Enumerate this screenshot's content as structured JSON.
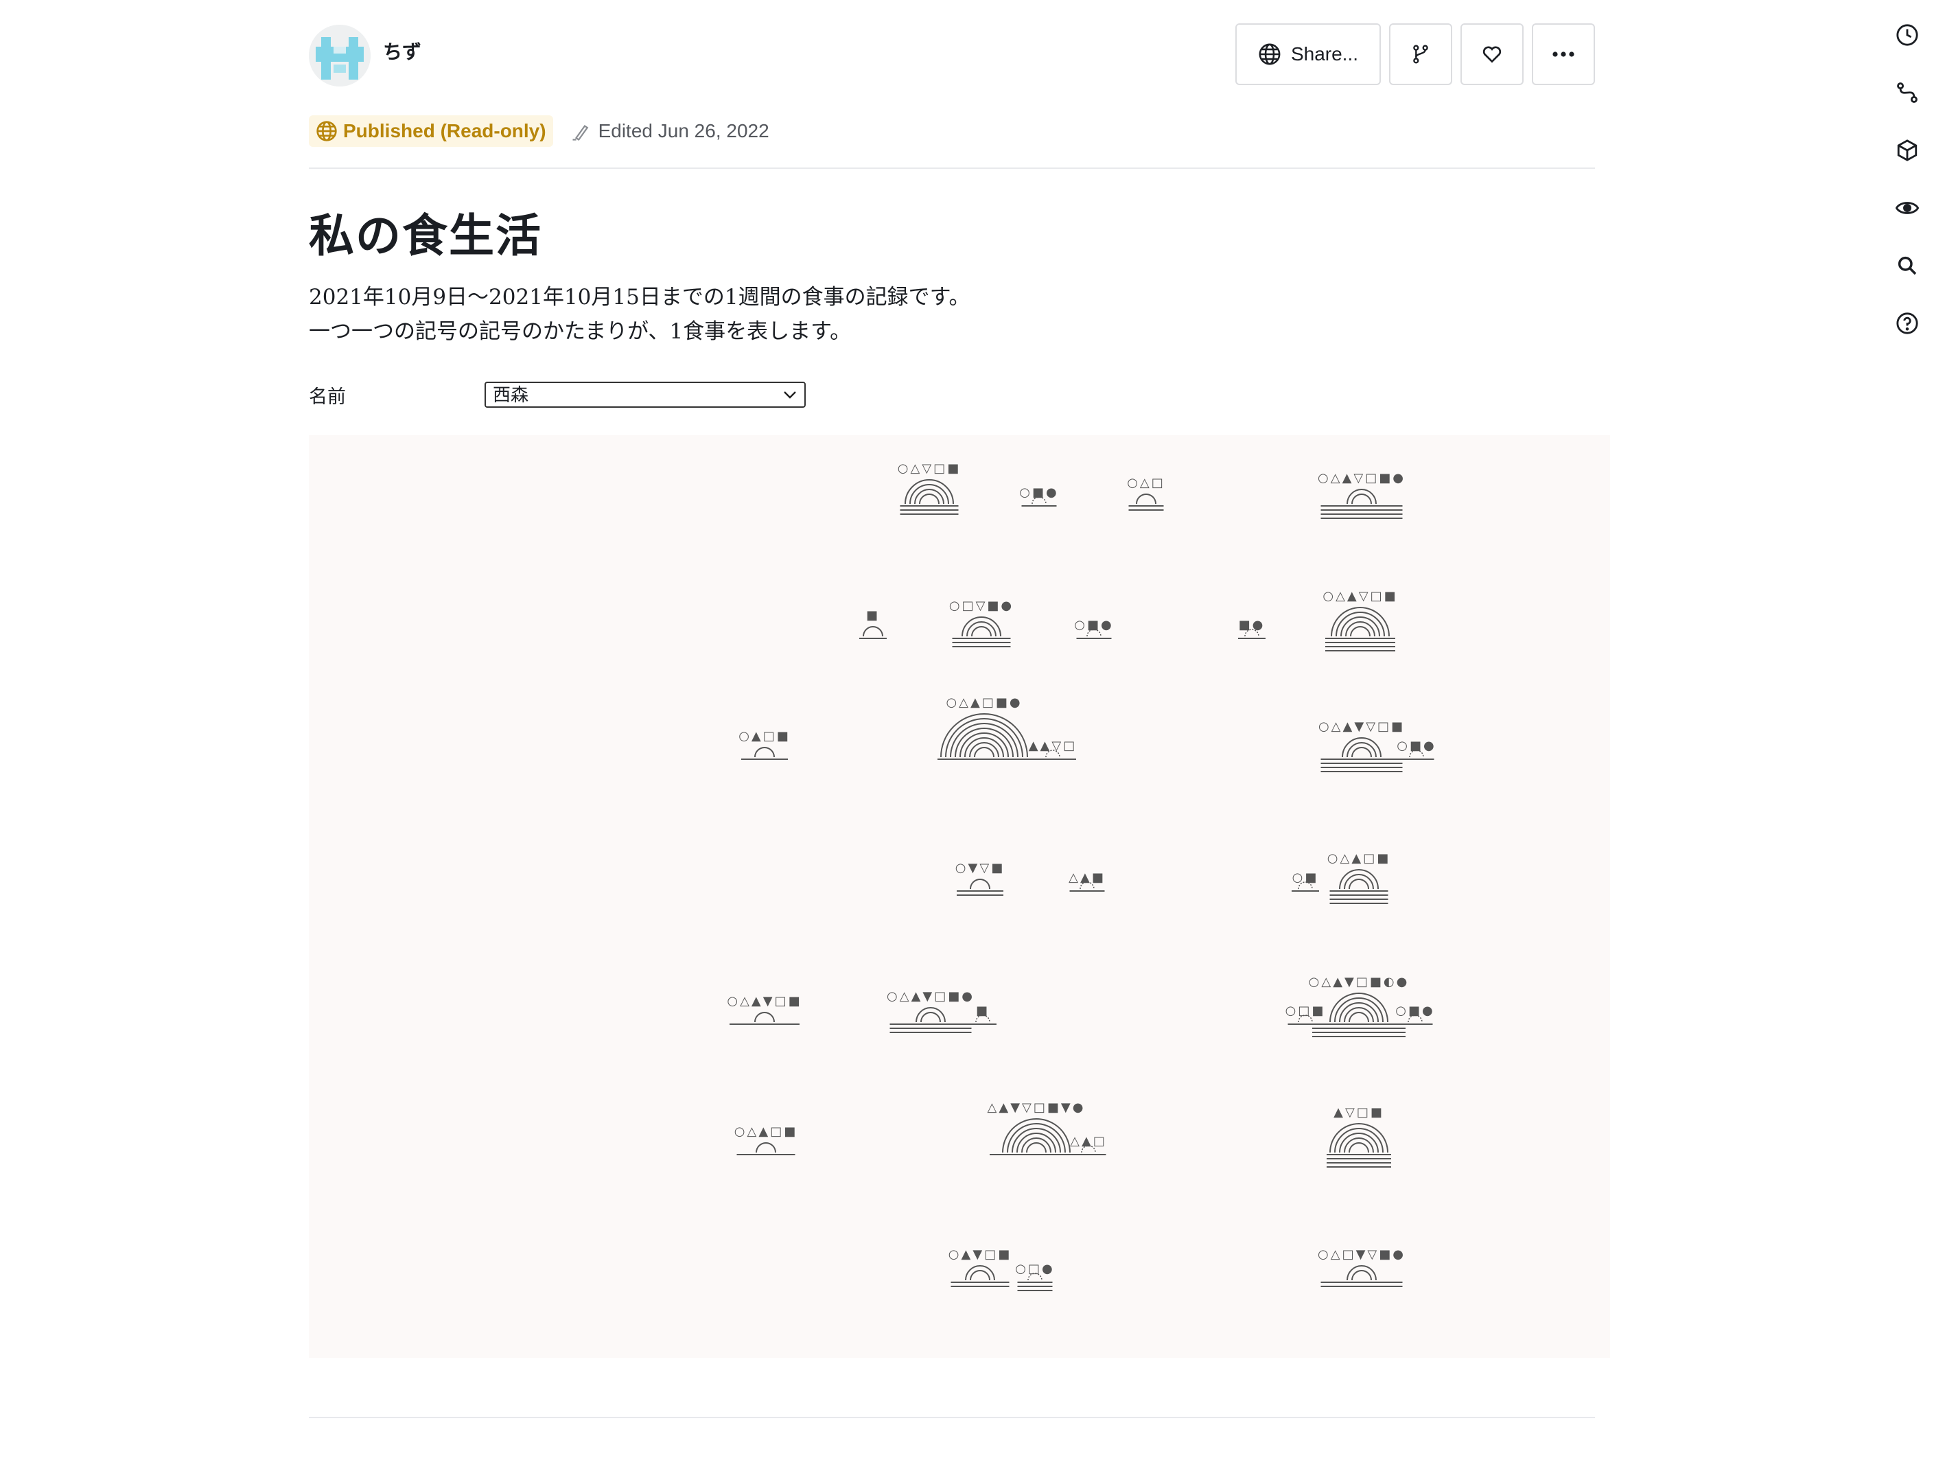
{
  "header": {
    "author_name": "ちず",
    "share_label": "Share...",
    "status_badge": "Published (Read-only)",
    "edited": "Edited Jun 26, 2022"
  },
  "content": {
    "title": "私の食生活",
    "description_lines": [
      "2021年10月9日〜2021年10月15日までの1週間の食事の記録です。",
      "一つ一つの記号の記号のかたまりが、1食事を表します。"
    ],
    "name_label": "名前",
    "name_selected": "西森"
  },
  "colors": {
    "accent": "#b8860b",
    "badge_bg": "#fdf6e3",
    "canvas_bg": "#fcf9f8",
    "avatar": "#7fd3e6",
    "ink": "#555555"
  },
  "icons": {
    "header": [
      "globe-icon",
      "fork-icon",
      "heart-icon",
      "more-icon"
    ],
    "rail": [
      "history-icon",
      "links-icon",
      "package-icon",
      "eye-icon",
      "search-icon",
      "help-icon"
    ]
  },
  "meals": [
    {
      "symbols": "○△▽□■",
      "arcs": 4,
      "lines": 3
    },
    {
      "symbols": "○■●",
      "arcs": 0,
      "lines": 1
    },
    {
      "symbols": "○△□",
      "arcs": 1,
      "lines": 2
    },
    {
      "symbols": "○△▲▽□■●",
      "arcs": 2,
      "lines": 4
    },
    {
      "symbols": "■",
      "arcs": 1,
      "lines": 1
    },
    {
      "symbols": "○□▽■●",
      "arcs": 3,
      "lines": 3
    },
    {
      "symbols": "○■●",
      "arcs": 0,
      "lines": 1
    },
    {
      "symbols": "■●",
      "arcs": 0,
      "lines": 1
    },
    {
      "symbols": "○△▲▽□■",
      "arcs": 5,
      "lines": 4
    },
    {
      "symbols": "○▲□■",
      "arcs": 1,
      "lines": 1
    },
    {
      "symbols": "○△▲□■●",
      "arcs": 8,
      "lines": 1
    },
    {
      "symbols": "▲▲▽□",
      "arcs": 0,
      "lines": 1
    },
    {
      "symbols": "○△▲▼▽□■",
      "arcs": 3,
      "lines": 4
    },
    {
      "symbols": "○■●",
      "arcs": 0,
      "lines": 1
    },
    {
      "symbols": "○▼▽■",
      "arcs": 1,
      "lines": 2
    },
    {
      "symbols": "△▲■",
      "arcs": 0,
      "lines": 1
    },
    {
      "symbols": "○■",
      "arcs": 0,
      "lines": 1
    },
    {
      "symbols": "○△▲□■",
      "arcs": 3,
      "lines": 4
    },
    {
      "symbols": "○△▲▼□■",
      "arcs": 1,
      "lines": 1
    },
    {
      "symbols": "○△▲▼□■●",
      "arcs": 2,
      "lines": 3
    },
    {
      "symbols": "■",
      "arcs": 0,
      "lines": 1
    },
    {
      "symbols": "○□■",
      "arcs": 0,
      "lines": 1
    },
    {
      "symbols": "○△▲▼□■◐●",
      "arcs": 5,
      "lines": 4
    },
    {
      "symbols": "○■●",
      "arcs": 0,
      "lines": 1
    },
    {
      "symbols": "○△▲□■",
      "arcs": 1,
      "lines": 1
    },
    {
      "symbols": "△▲▼▽□■▼●",
      "arcs": 6,
      "lines": 1
    },
    {
      "symbols": "△▲□",
      "arcs": 0,
      "lines": 1
    },
    {
      "symbols": "▲▽□■",
      "arcs": 5,
      "lines": 4
    },
    {
      "symbols": "○▲▼□■",
      "arcs": 2,
      "lines": 2
    },
    {
      "symbols": "○□●",
      "arcs": 0,
      "lines": 3
    },
    {
      "symbols": "○△□▼▽■●",
      "arcs": 2,
      "lines": 2
    }
  ]
}
